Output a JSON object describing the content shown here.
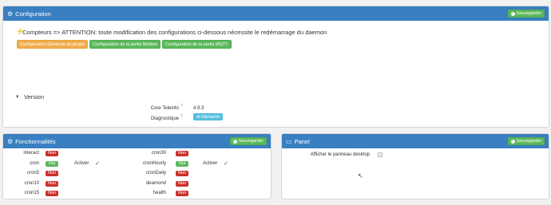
{
  "config": {
    "title": "Configuration",
    "save_label": "Sauvegarder",
    "attention": "Compteurs => ATTENTION: toute modification des configurations ci-dessous nécessite le redémarrage du daemon",
    "buttons": [
      "Configuration Générale du plugin",
      "Configuration de la partie Modem",
      "Configuration de la partie MQTT"
    ],
    "version_title": "Version",
    "core_label": "Core Teleinfo",
    "core_value": "4.9.3",
    "diag_label": "Diagnostique",
    "diag_button": "Démarrer"
  },
  "fonctionnalites": {
    "title": "Fonctionnalités",
    "save_label": "Sauvegarder",
    "left": [
      {
        "name": "interact",
        "status": "Non",
        "color": "red"
      },
      {
        "name": "cron",
        "status": "Oui",
        "color": "green",
        "extra": "Activer"
      },
      {
        "name": "cron5",
        "status": "Non",
        "color": "red"
      },
      {
        "name": "cron10",
        "status": "Non",
        "color": "red"
      },
      {
        "name": "cron15",
        "status": "Non",
        "color": "red"
      }
    ],
    "right": [
      {
        "name": "cron30",
        "status": "Non",
        "color": "red"
      },
      {
        "name": "cronHourly",
        "status": "Oui",
        "color": "green",
        "extra": "Activer"
      },
      {
        "name": "cronDaily",
        "status": "Non",
        "color": "red"
      },
      {
        "name": "deamond",
        "status": "Non",
        "color": "red"
      },
      {
        "name": "health",
        "status": "Non",
        "color": "red"
      }
    ]
  },
  "panel": {
    "title": "Panel",
    "save_label": "Sauvegarder",
    "desktop_label": "Afficher le panneau desktop"
  },
  "colors": {
    "header": "#3a7fc1",
    "green": "#5cb85c",
    "red": "#c9302c",
    "orange": "#f0ad4e",
    "blue": "#5bc0de"
  }
}
